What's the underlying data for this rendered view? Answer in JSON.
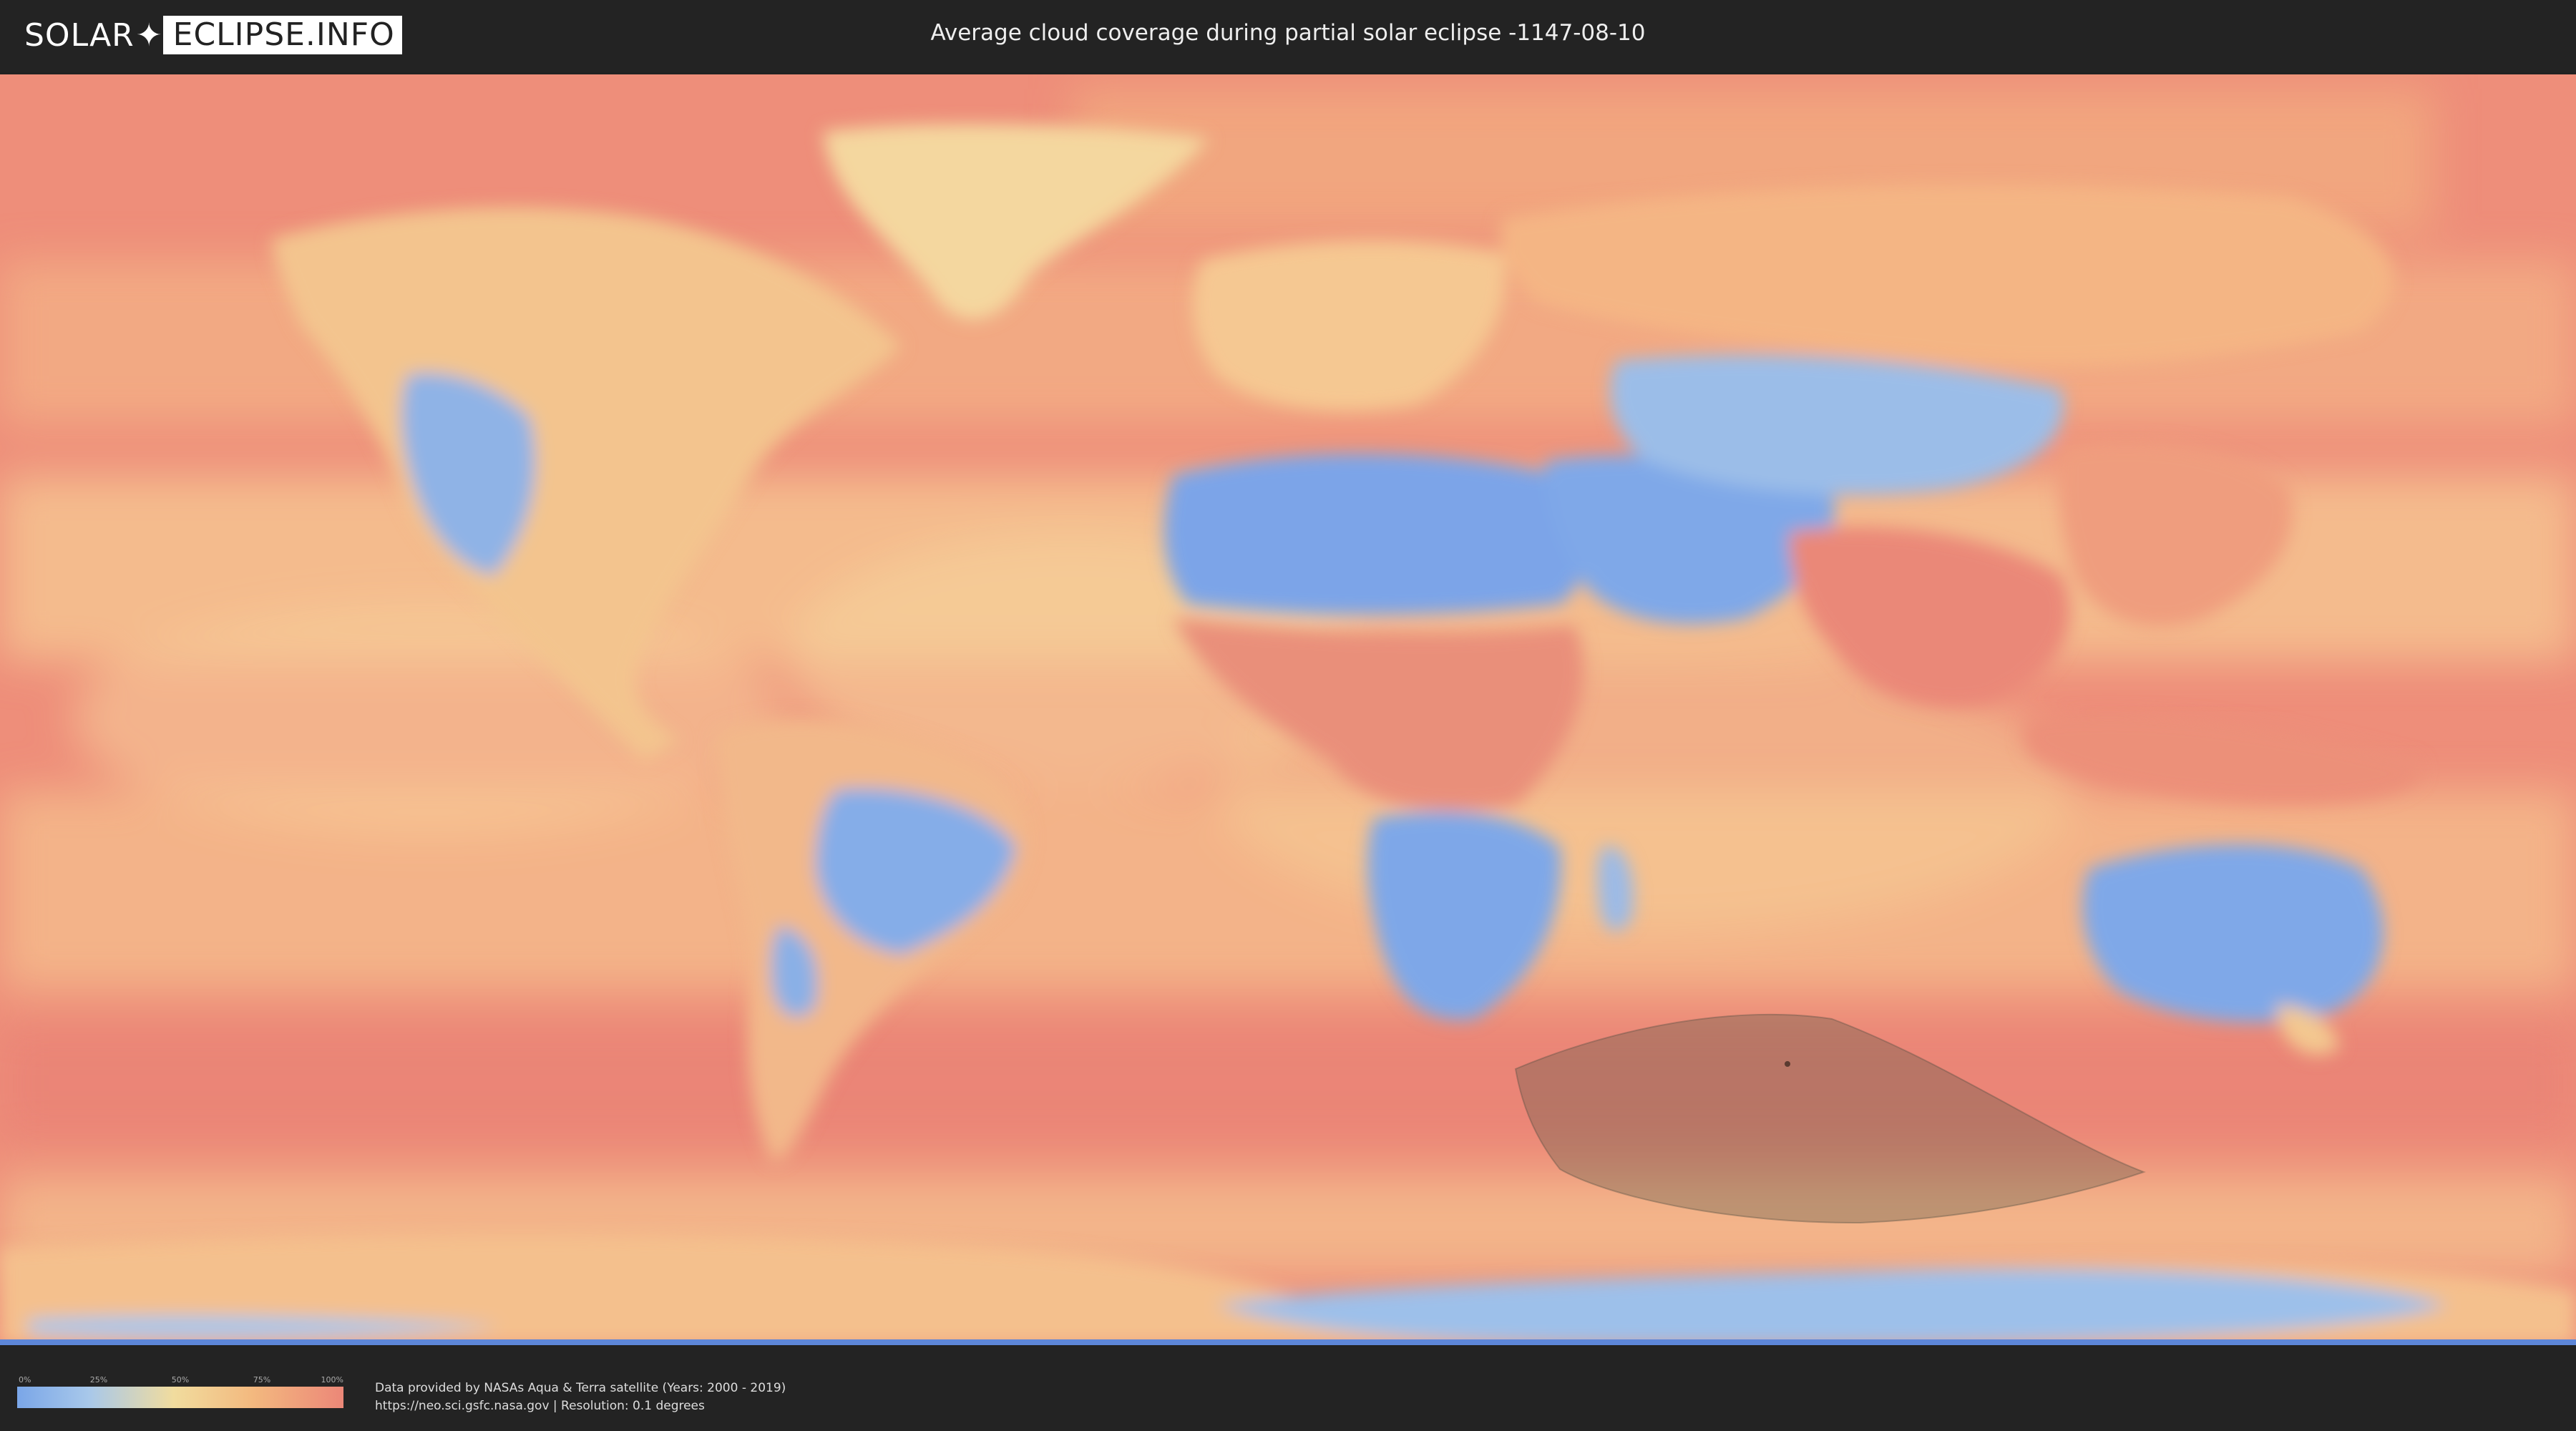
{
  "header": {
    "logo_left": "SOLAR",
    "logo_right": "ECLIPSE.INFO",
    "title": "Average cloud coverage during partial solar eclipse -1147-08-10"
  },
  "map": {
    "shadow_color": "#5c5a48",
    "cloud_color_scale": [
      "#7aa6e8",
      "#a8c8ea",
      "#f1dc9e",
      "#f3b97f",
      "#ec8778"
    ]
  },
  "legend": {
    "ticks": [
      "0%",
      "25%",
      "50%",
      "75%",
      "100%"
    ]
  },
  "footer": {
    "credit_line1": "Data provided by NASAs Aqua & Terra satellite (Years: 2000 - 2019)",
    "credit_line2": "https://neo.sci.gsfc.nasa.gov | Resolution: 0.1 degrees"
  }
}
